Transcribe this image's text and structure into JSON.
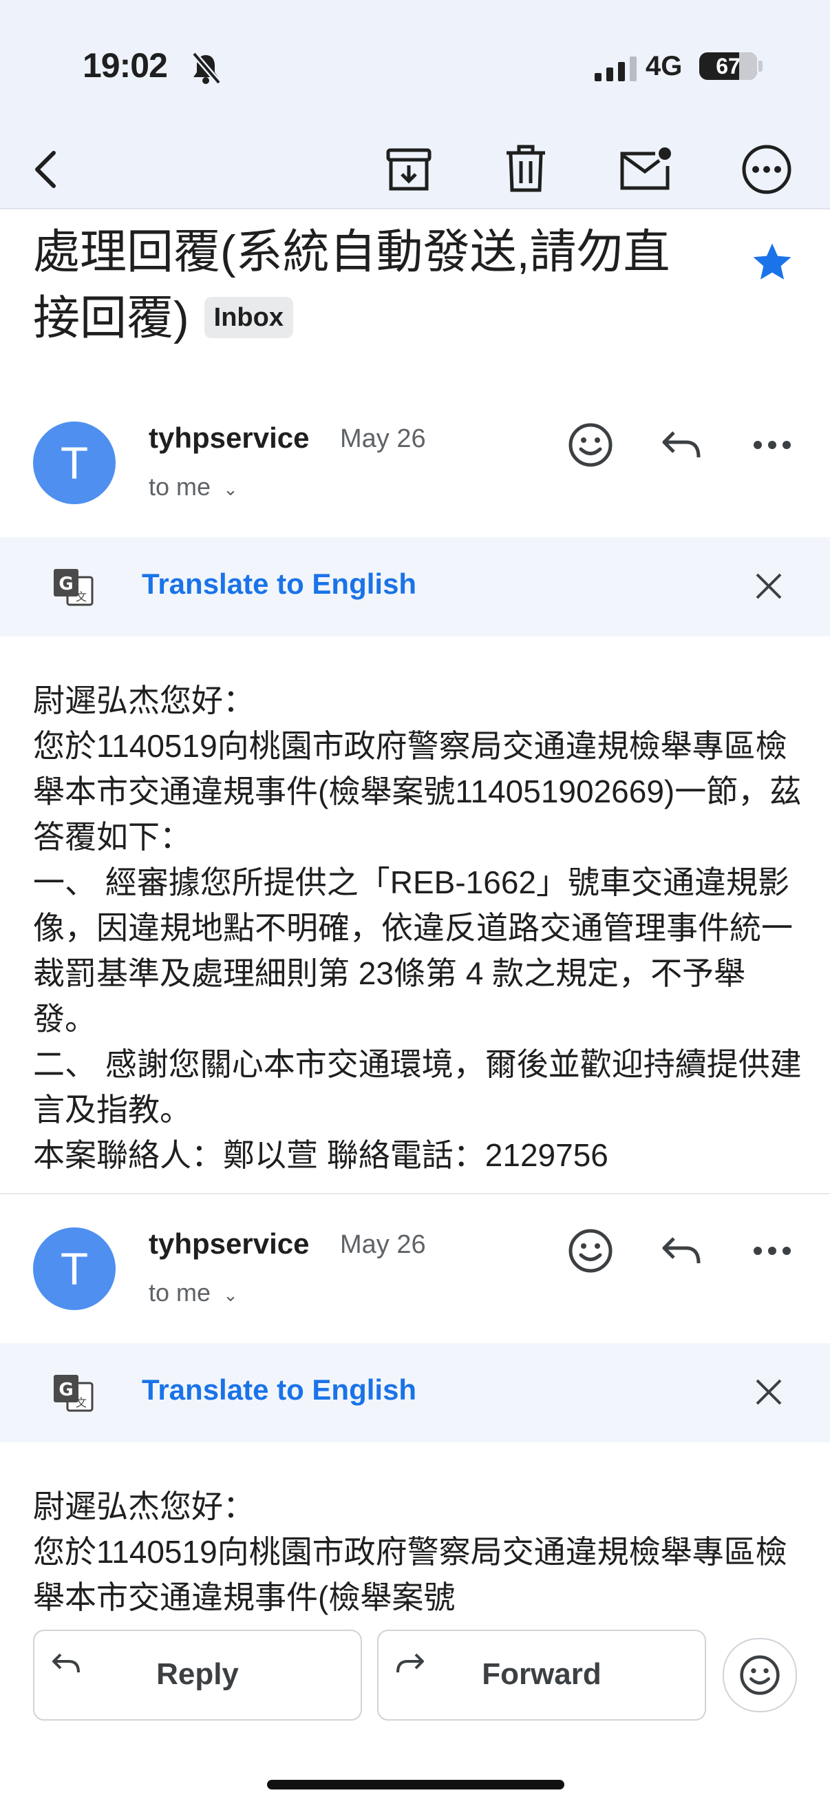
{
  "status_bar": {
    "time": "19:02",
    "network": "4G",
    "battery": "67"
  },
  "thread": {
    "subject": "處理回覆(系統自動發送,請勿直接回覆)",
    "label": "Inbox"
  },
  "messages": [
    {
      "avatar_letter": "T",
      "sender": "tyhpservice",
      "date": "May 26",
      "recipient": "to me",
      "translate_label": "Translate to English",
      "body": "尉遲弘杰您好：\n您於1140519向桃園市政府警察局交通違規檢舉專區檢舉本市交通違規事件(檢舉案號114051902669)一節，茲答覆如下：\n一、 經審據您所提供之「REB-1662」號車交通違規影像，因違規地點不明確，依違反道路交通管理事件統一裁罰基準及處理細則第 23條第 4 款之規定，不予舉發。\n二、 感謝您關心本市交通環境，爾後並歡迎持續提供建言及指教。\n本案聯絡人：鄭以萱 聯絡電話：2129756"
    },
    {
      "avatar_letter": "T",
      "sender": "tyhpservice",
      "date": "May 26",
      "recipient": "to me",
      "translate_label": "Translate to English",
      "body": "尉遲弘杰您好：\n您於1140519向桃園市政府警察局交通違規檢舉專區檢舉本市交通違規事件(檢舉案號"
    }
  ],
  "actions": {
    "reply_label": "Reply",
    "forward_label": "Forward"
  },
  "colors": {
    "accent": "#1a73e8",
    "avatar": "#4f8ff0",
    "star": "#1a73e8",
    "bar_bg": "#eef3fb"
  }
}
